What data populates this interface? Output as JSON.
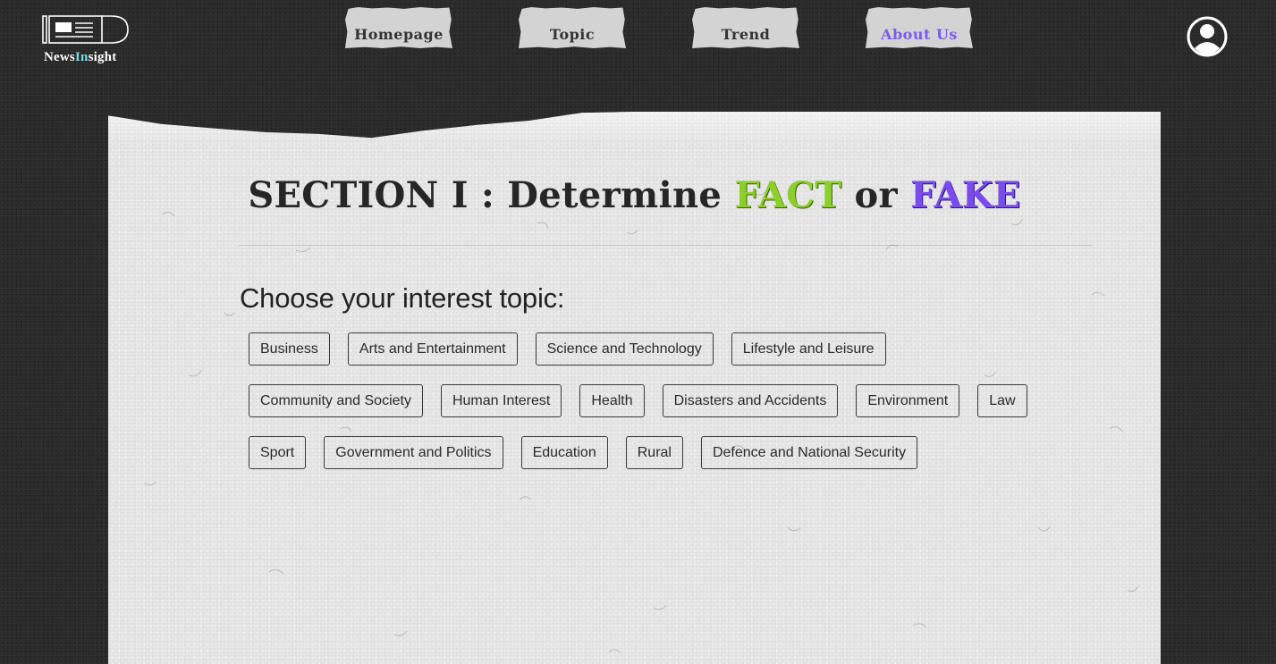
{
  "header": {
    "logo": {
      "name_part1": "News",
      "name_part2": "In",
      "name_part3": "sight"
    },
    "nav": [
      {
        "label": "Homepage",
        "active": false
      },
      {
        "label": "Topic",
        "active": false
      },
      {
        "label": "Trend",
        "active": false
      },
      {
        "label": "About Us",
        "active": true
      }
    ],
    "profile_icon": "user-circle-icon"
  },
  "main": {
    "title": {
      "prefix": "SECTION I : Determine ",
      "fact": "FACT",
      "middle": " or ",
      "fake": "FAKE"
    },
    "topics_heading": "Choose your interest topic:",
    "topic_rows": [
      [
        "Business",
        "Arts and Entertainment",
        "Science and Technology",
        "Lifestyle and Leisure"
      ],
      [
        "Community and Society",
        "Human Interest",
        "Health",
        "Disasters and Accidents",
        "Environment",
        "Law"
      ],
      [
        "Sport",
        "Government and Politics",
        "Education",
        "Rural",
        "Defence and National Security"
      ]
    ]
  },
  "colors": {
    "background": "#2a2a2a",
    "paper": "#e6e6e6",
    "nav_tab": "#d3d3d3",
    "active_nav": "#7a5cf0",
    "fact_green": "#8ccf2a",
    "fake_purple": "#7a4cf0",
    "logo_accent": "#6ee0e6"
  }
}
